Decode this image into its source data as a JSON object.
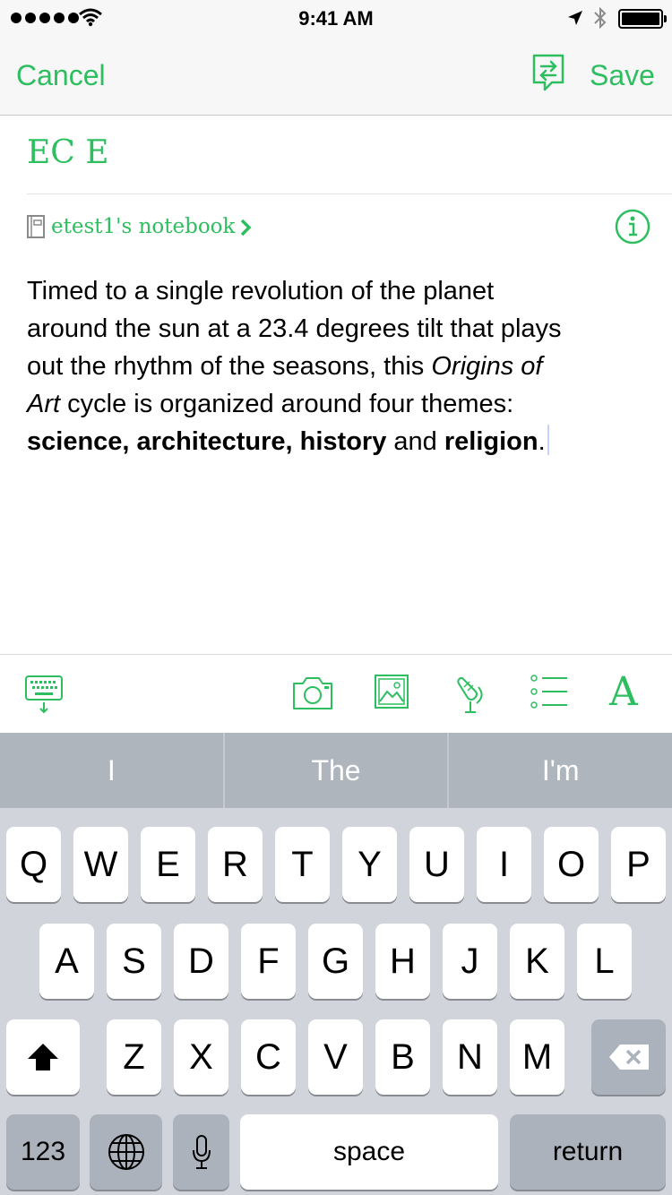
{
  "status_bar": {
    "time": "9:41 AM"
  },
  "nav": {
    "cancel_label": "Cancel",
    "save_label": "Save"
  },
  "note": {
    "title": "EC E",
    "notebook": "etest1's notebook",
    "body": {
      "l1": "Timed to a single revolution of the planet",
      "l2": "around the sun at a 23.4 degrees tilt that plays",
      "l3_a": "out the rhythm of the seasons, this ",
      "l3_b": "Origins of",
      "l4_a": "Art",
      "l4_b": " cycle is organized around four themes:",
      "l5_a": "science, architecture, history",
      "l5_b": " and ",
      "l5_c": "religion",
      "l5_d": "."
    }
  },
  "toolbar": {
    "icons": [
      "keyboard-icon",
      "camera-icon",
      "image-icon",
      "microphone-icon",
      "list-icon",
      "text-format-icon"
    ],
    "format_glyph": "A"
  },
  "suggestions": [
    "I",
    "The",
    "I'm"
  ],
  "keyboard": {
    "row1": [
      "Q",
      "W",
      "E",
      "R",
      "T",
      "Y",
      "U",
      "I",
      "O",
      "P"
    ],
    "row2": [
      "A",
      "S",
      "D",
      "F",
      "G",
      "H",
      "J",
      "K",
      "L"
    ],
    "row3": [
      "Z",
      "X",
      "C",
      "V",
      "B",
      "N",
      "M"
    ],
    "numbers_label": "123",
    "space_label": "space",
    "return_label": "return"
  },
  "colors": {
    "accent": "#2dbe60",
    "keyboard_bg": "#d1d5db",
    "suggestion_bg": "#aeb5bd"
  }
}
